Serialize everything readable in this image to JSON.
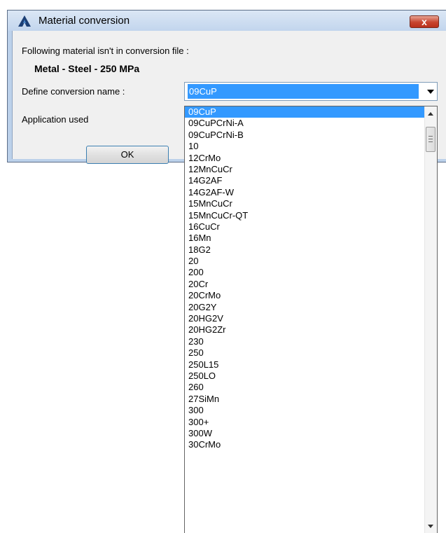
{
  "window": {
    "title": "Material conversion",
    "close_label": "x"
  },
  "dialog": {
    "message": "Following material isn't in conversion file :",
    "material_name": "Metal - Steel - 250 MPa",
    "conversion_label": "Define conversion name :",
    "application_label": "Application used",
    "ok_label": "OK"
  },
  "combo": {
    "selected": "09CuP",
    "options": [
      "09CuP",
      "09CuPCrNi-A",
      "09CuPCrNi-B",
      "10",
      "12CrMo",
      "12MnCuCr",
      "14G2AF",
      "14G2AF-W",
      "15MnCuCr",
      "15MnCuCr-QT",
      "16CuCr",
      "16Mn",
      "18G2",
      "20",
      "200",
      "20Cr",
      "20CrMo",
      "20G2Y",
      "20HG2V",
      "20HG2Zr",
      "230",
      "250",
      "250L15",
      "250LO",
      "260",
      "27SiMn",
      "300",
      "300+",
      "300W",
      "30CrMo"
    ]
  },
  "colors": {
    "selection": "#3399ff",
    "title_bar": "#c2d5ed",
    "close_button": "#c7442e"
  }
}
